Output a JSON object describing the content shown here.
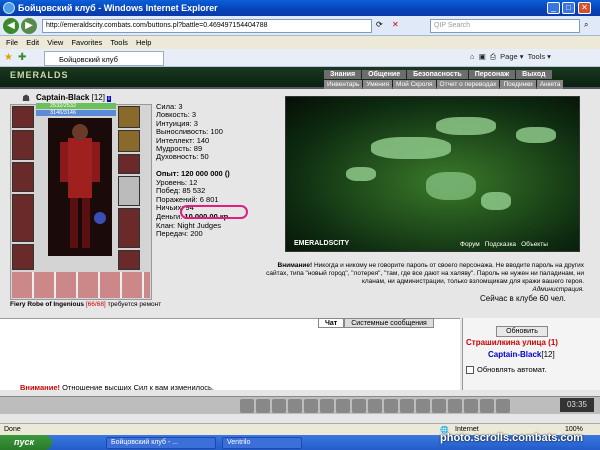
{
  "window": {
    "title": "Бойцовский клуб - Windows Internet Explorer"
  },
  "address": {
    "url": "http://emeraldscity.combats.com/buttons.pl?battle=0.469497154404788",
    "search_placeholder": "QIP Search"
  },
  "menu": [
    "File",
    "Edit",
    "View",
    "Favorites",
    "Tools",
    "Help"
  ],
  "tab": {
    "label": "Бойцовский клуб"
  },
  "toolbar_right": {
    "page": "Page",
    "tools": "Tools"
  },
  "site": {
    "logo": "EMERALDS"
  },
  "topnav_main": [
    "Знания",
    "Общение",
    "Безопасность",
    "Персонаж",
    "Выход"
  ],
  "topnav_sub": [
    "Инвентарь",
    "Умения",
    "Мой Скроля",
    "Отчет о переводах",
    "Поединки",
    "Анкета"
  ],
  "character": {
    "name": "Captain-Black",
    "level": "[12]",
    "hp": "2532/2532",
    "mp": "3146/3146",
    "item_name": "Fiery Robe of Ingenious",
    "item_dur": "[66/68]",
    "item_note": "требуется ремонт"
  },
  "stats": [
    "Сила: 3",
    "Ловкость: 3",
    "Интуиция: 3",
    "Выносливость: 100",
    "Интеллект: 140",
    "Мудрость: 89",
    "Духовность: 50"
  ],
  "stats2": {
    "exp": "Опыт: 120 000 000 ()",
    "level": "Уровень: 12",
    "wins": "Побед: 85 532",
    "losses": "Поражений: 6 801",
    "draws": "Ничьих: 94",
    "money_label": "Деньги:",
    "money": "10 000.00 кр.",
    "clan": "Клан: Night Judges",
    "transfers": "Передач: 200"
  },
  "scene": {
    "name": "EMERALDSCITY",
    "links": [
      "Форум",
      "Подсказка",
      "Объекты"
    ]
  },
  "warning": {
    "title": "Внимание!",
    "text": "Никогда и никому не говорите пароль от своего персонажа. Не вводите пароль на других сайтах, типа \"новый город\", \"лотерея\", \"там, где все дают на халяву\". Пароль не нужен ни паладинам, ни кланам, ни администрации, только взломщикам для кражи вашего героя.",
    "signature": "Администрация."
  },
  "online": "Сейчас в клубе 60 чел.",
  "chat": {
    "tabs": [
      "Чат",
      "Системные сообщения"
    ],
    "line_label": "Внимание!",
    "line_text": "Отношение высших Сил к вам изменилось."
  },
  "right": {
    "refresh": "Обновить",
    "street": "Страшилкина улица (1)",
    "player": "Captain-Black",
    "player_level": "[12]",
    "auto": "Обновлять автомат."
  },
  "clock": "03:35",
  "status": {
    "left": "Done",
    "zone": "Internet",
    "zoom": "100%"
  },
  "taskbar": {
    "start": "пуск",
    "tasks": [
      "Бойцовский клуб - ...",
      "Ventrilo"
    ]
  },
  "watermark": "photo.scrolls.combats.com"
}
